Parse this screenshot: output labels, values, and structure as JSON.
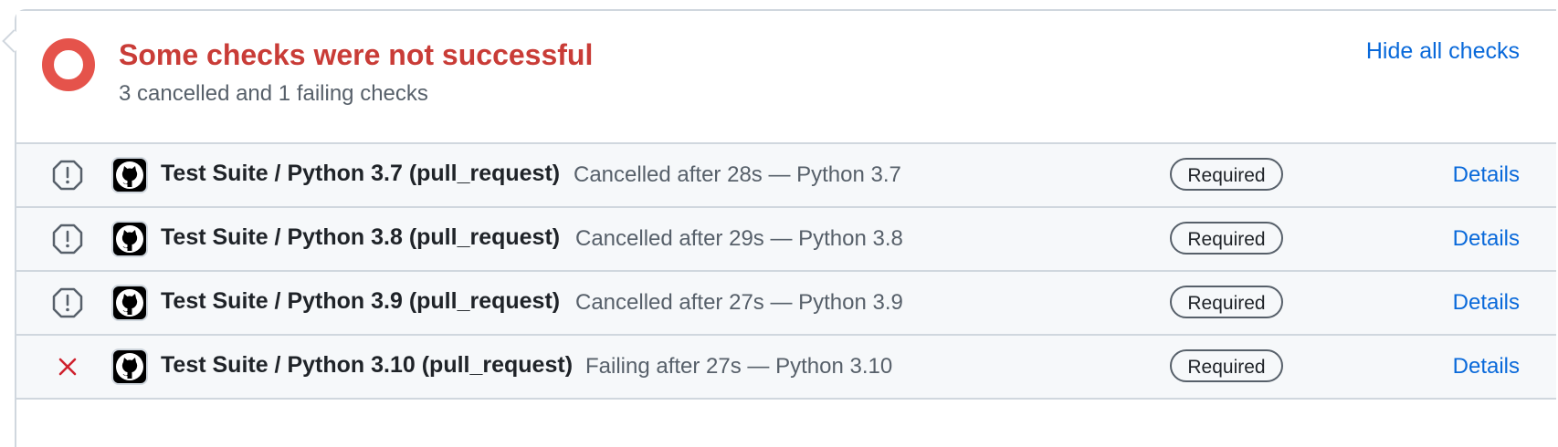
{
  "header": {
    "title": "Some checks were not successful",
    "subtitle": "3 cancelled and 1 failing checks",
    "hide_all_checks_label": "Hide all checks"
  },
  "colors": {
    "failure": "#e5534b",
    "title": "#c93c37",
    "link": "#0969da",
    "cancelled_icon": "#57606a",
    "failed_icon": "#cf222e"
  },
  "checks": [
    {
      "status_icon": "cancelled-icon",
      "name": "Test Suite / Python 3.7 (pull_request)",
      "description": "Cancelled after 28s — Python 3.7",
      "badge": "Required",
      "details_label": "Details"
    },
    {
      "status_icon": "cancelled-icon",
      "name": "Test Suite / Python 3.8 (pull_request)",
      "description": "Cancelled after 29s — Python 3.8",
      "badge": "Required",
      "details_label": "Details"
    },
    {
      "status_icon": "cancelled-icon",
      "name": "Test Suite / Python 3.9 (pull_request)",
      "description": "Cancelled after 27s — Python 3.9",
      "badge": "Required",
      "details_label": "Details"
    },
    {
      "status_icon": "failed-icon",
      "name": "Test Suite / Python 3.10 (pull_request)",
      "description": "Failing after 27s — Python 3.10",
      "badge": "Required",
      "details_label": "Details"
    }
  ]
}
